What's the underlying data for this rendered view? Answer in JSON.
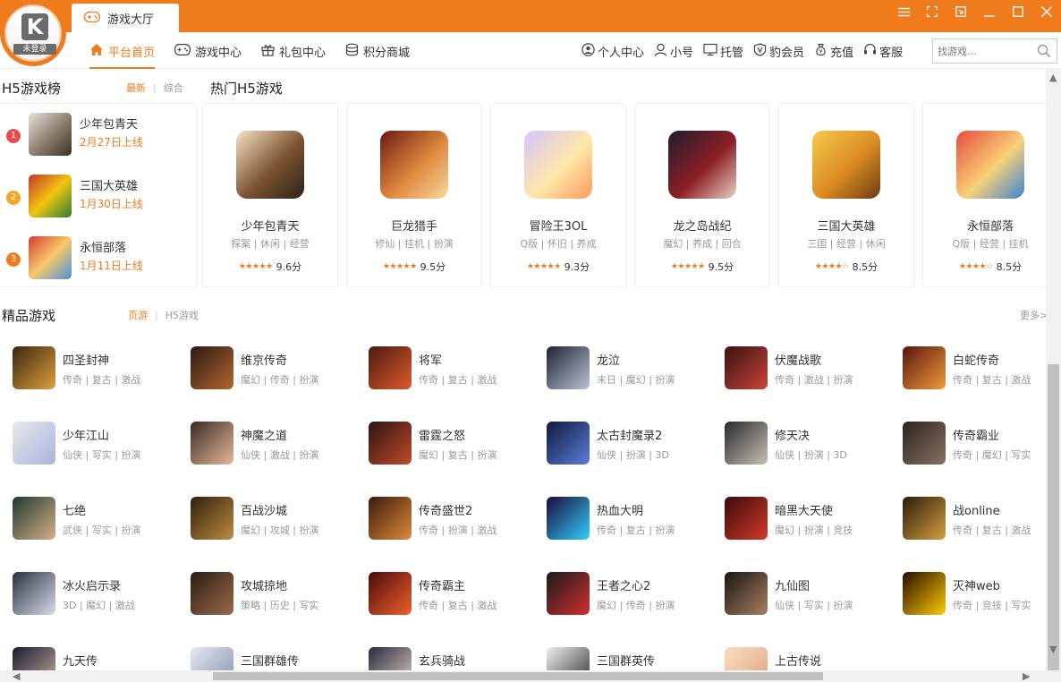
{
  "tab": {
    "title": "游戏大厅",
    "icon": "gamepad-icon"
  },
  "logo": {
    "text": "未登录",
    "letter": "K"
  },
  "window_controls": [
    "menu-icon",
    "fullscreen-icon",
    "restore-icon",
    "minimize-icon",
    "maximize-icon",
    "close-icon"
  ],
  "nav": [
    {
      "label": "平台首页",
      "icon": "home-icon",
      "active": true
    },
    {
      "label": "游戏中心",
      "icon": "gamepad-icon"
    },
    {
      "label": "礼包中心",
      "icon": "gift-icon"
    },
    {
      "label": "积分商城",
      "icon": "coins-icon"
    }
  ],
  "user_nav": [
    {
      "label": "个人中心",
      "icon": "user-circle-icon"
    },
    {
      "label": "小号",
      "icon": "user-icon"
    },
    {
      "label": "托管",
      "icon": "monitor-icon"
    },
    {
      "label": "豹会员",
      "icon": "badge-icon"
    },
    {
      "label": "充值",
      "icon": "bag-icon"
    },
    {
      "label": "客服",
      "icon": "headset-icon"
    }
  ],
  "search": {
    "placeholder": "找游戏..."
  },
  "h5_rank": {
    "title": "H5游戏榜",
    "tabs": [
      "最新",
      "综合"
    ],
    "items": [
      {
        "num": "1",
        "name": "少年包青天",
        "date": "2月27日上线"
      },
      {
        "num": "2",
        "name": "三国大英雄",
        "date": "1月30日上线"
      },
      {
        "num": "3",
        "name": "永恒部落",
        "date": "1月11日上线"
      }
    ]
  },
  "hot_h5": {
    "title": "热门H5游戏",
    "cards": [
      {
        "name": "少年包青天",
        "tags": "探案 | 休闲 | 经营",
        "score": "9.6分",
        "stars": 5
      },
      {
        "name": "巨龙猎手",
        "tags": "修仙 | 挂机 | 扮演",
        "score": "9.5分",
        "stars": 5
      },
      {
        "name": "冒险王3OL",
        "tags": "Q版 | 怀旧 | 养成",
        "score": "9.3分",
        "stars": 5
      },
      {
        "name": "龙之岛战纪",
        "tags": "魔幻 | 养成 | 回合",
        "score": "9.5分",
        "stars": 5
      },
      {
        "name": "三国大英雄",
        "tags": "三国 | 经营 | 休闲",
        "score": "8.5分",
        "stars": 4.5
      },
      {
        "name": "永恒部落",
        "tags": "Q版 | 经营 | 挂机",
        "score": "8.5分",
        "stars": 4.5
      }
    ]
  },
  "featured": {
    "title": "精品游戏",
    "tabs": [
      "页游",
      "H5游戏"
    ],
    "more": "更多>",
    "games": [
      {
        "name": "四圣封神",
        "tags": "传奇 | 复古 | 激战"
      },
      {
        "name": "维京传奇",
        "tags": "魔幻 | 传奇 | 扮演"
      },
      {
        "name": "将军",
        "tags": "传奇 | 复古 | 激战"
      },
      {
        "name": "龙泣",
        "tags": "末日 | 魔幻 | 扮演"
      },
      {
        "name": "伏魔战歌",
        "tags": "传奇 | 激战 | 扮演"
      },
      {
        "name": "白蛇传奇",
        "tags": "传奇 | 复古 | 激战"
      },
      {
        "name": "少年江山",
        "tags": "仙侠 | 写实 | 扮演"
      },
      {
        "name": "神魔之道",
        "tags": "仙侠 | 激战 | 扮演"
      },
      {
        "name": "雷霆之怒",
        "tags": "魔幻 | 复古 | 扮演"
      },
      {
        "name": "太古封魔录2",
        "tags": "仙侠 | 扮演 | 3D"
      },
      {
        "name": "修天决",
        "tags": "仙侠 | 扮演 | 3D"
      },
      {
        "name": "传奇霸业",
        "tags": "传奇 | 魔幻 | 写实"
      },
      {
        "name": "七绝",
        "tags": "武侠 | 写实 | 扮演"
      },
      {
        "name": "百战沙城",
        "tags": "魔幻 | 攻城 | 扮演"
      },
      {
        "name": "传奇盛世2",
        "tags": "传奇 | 扮演 | 激战"
      },
      {
        "name": "热血大明",
        "tags": "传奇 | 复古 | 扮演"
      },
      {
        "name": "暗黑大天使",
        "tags": "魔幻 | 扮演 | 竞技"
      },
      {
        "name": "战online",
        "tags": "传奇 | 复古 | 激战"
      },
      {
        "name": "冰火启示录",
        "tags": "3D | 魔幻 | 激战"
      },
      {
        "name": "攻城掠地",
        "tags": "策略 | 历史 | 写实"
      },
      {
        "name": "传奇霸主",
        "tags": "传奇 | 复古 | 激战"
      },
      {
        "name": "王者之心2",
        "tags": "魔幻 | 传奇 | 扮演"
      },
      {
        "name": "九仙图",
        "tags": "仙侠 | 写实 | 扮演"
      },
      {
        "name": "灭神web",
        "tags": "传奇 | 竞技 | 写实"
      },
      {
        "name": "九天传",
        "tags": ""
      },
      {
        "name": "三国群雄传",
        "tags": ""
      },
      {
        "name": "玄兵骑战",
        "tags": ""
      },
      {
        "name": "三国群英传",
        "tags": ""
      },
      {
        "name": "上古传说",
        "tags": ""
      }
    ]
  },
  "colors": {
    "accent": "#ef7b1d",
    "rank1": "#e94b4b",
    "rank2": "#f5a623",
    "rank3": "#ef7b1d"
  }
}
